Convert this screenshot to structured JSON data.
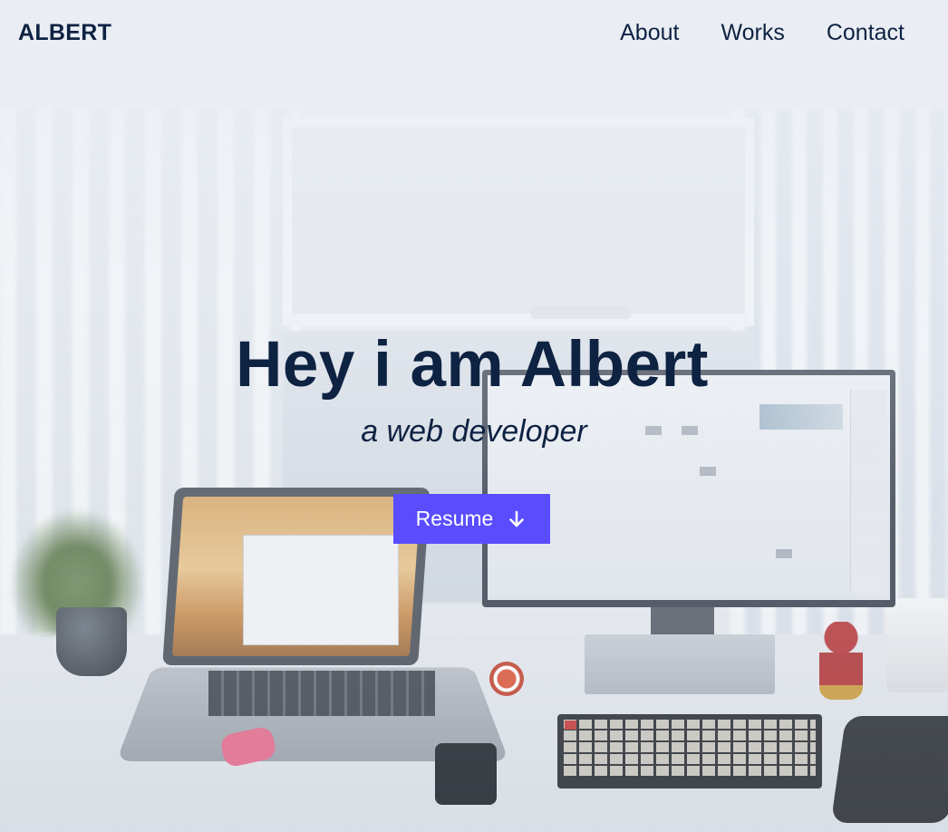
{
  "header": {
    "brand": "ALBERT",
    "nav": [
      {
        "label": "About"
      },
      {
        "label": "Works"
      },
      {
        "label": "Contact"
      }
    ]
  },
  "hero": {
    "title": "Hey i am Albert",
    "subtitle": "a web developer",
    "cta_label": "Resume",
    "cta_icon": "arrow-down-icon"
  },
  "colors": {
    "text": "#0e2242",
    "accent": "#5a4dff",
    "background": "#e9edf3"
  }
}
